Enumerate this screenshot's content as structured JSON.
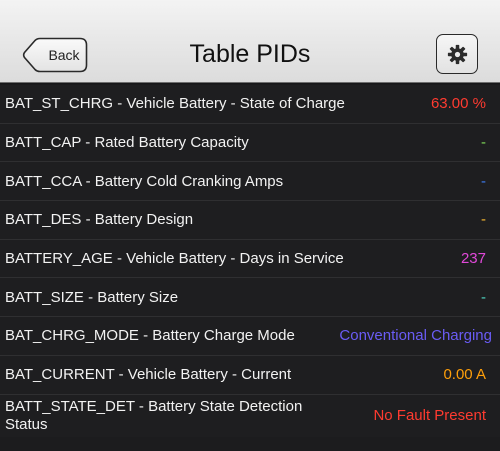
{
  "header": {
    "title": "Table PIDs",
    "back_label": "Back"
  },
  "rows": [
    {
      "label": "BAT_ST_CHRG - Vehicle Battery - State of Charge",
      "value": "63.00 %",
      "color": "#ff3b30"
    },
    {
      "label": "BATT_CAP - Rated Battery Capacity",
      "value": "-",
      "color": "#7ed957"
    },
    {
      "label": "BATT_CCA - Battery Cold Cranking Amps",
      "value": "-",
      "color": "#3d7cf0"
    },
    {
      "label": "BATT_DES - Battery Design",
      "value": "-",
      "color": "#f5b731"
    },
    {
      "label": "BATTERY_AGE - Vehicle Battery - Days in Service",
      "value": "237",
      "color": "#e048d8"
    },
    {
      "label": "BATT_SIZE - Battery Size",
      "value": "-",
      "color": "#4fd6c2"
    },
    {
      "label": "BAT_CHRG_MODE - Battery Charge Mode",
      "value": "Conventional Charging",
      "color": "#6a5cf5"
    },
    {
      "label": "BAT_CURRENT - Vehicle Battery - Current",
      "value": "0.00 A",
      "color": "#ff9f0a"
    },
    {
      "label": "BATT_STATE_DET - Battery State Detection Status",
      "value": "No Fault Present",
      "color": "#ff3b30"
    }
  ],
  "icons": {
    "back": "chevron-left-button",
    "settings": "gear-icon"
  }
}
